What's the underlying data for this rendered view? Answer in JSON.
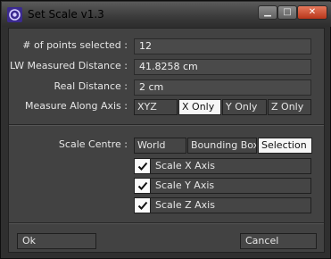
{
  "window": {
    "title": "Set Scale v1.3",
    "minimize_glyph": "▁",
    "maximize_glyph": "□",
    "close_glyph": "✕",
    "accent": "#b9361b"
  },
  "form": {
    "points_selected_label": "# of points selected :",
    "points_selected_value": "12",
    "lw_measured_label": "LW Measured Distance :",
    "lw_measured_value": "41.8258 cm",
    "real_distance_label": "Real Distance :",
    "real_distance_value": "2 cm",
    "measure_axis_label": "Measure Along Axis :",
    "measure_axis_options": [
      "XYZ",
      "X Only",
      "Y Only",
      "Z Only"
    ],
    "measure_axis_selected": "X Only",
    "scale_centre_label": "Scale Centre :",
    "scale_centre_options": [
      "World",
      "Bounding Box",
      "Selection"
    ],
    "scale_centre_selected": "Selection",
    "scale_x_label": "Scale X Axis",
    "scale_x_checked": true,
    "scale_y_label": "Scale Y Axis",
    "scale_y_checked": true,
    "scale_z_label": "Scale Z Axis",
    "scale_z_checked": true
  },
  "footer": {
    "ok_label": "Ok",
    "cancel_label": "Cancel"
  }
}
